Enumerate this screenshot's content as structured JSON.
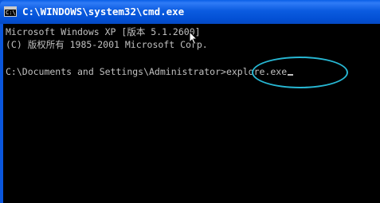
{
  "window": {
    "title": "C:\\WINDOWS\\system32\\cmd.exe",
    "icon": "cmd-console-icon",
    "icon_prompt": "C:\\"
  },
  "console": {
    "lines": [
      "Microsoft Windows XP [版本 5.1.2600]",
      "(C) 版权所有 1985-2001 Microsoft Corp."
    ],
    "prompt": "C:\\Documents and Settings\\Administrator>",
    "command": "explore.exe"
  },
  "annotation": {
    "color": "#27b7d3"
  },
  "colors": {
    "titlebar": "#0b5be0",
    "console_bg": "#000000",
    "console_text": "#c0c0c0"
  }
}
